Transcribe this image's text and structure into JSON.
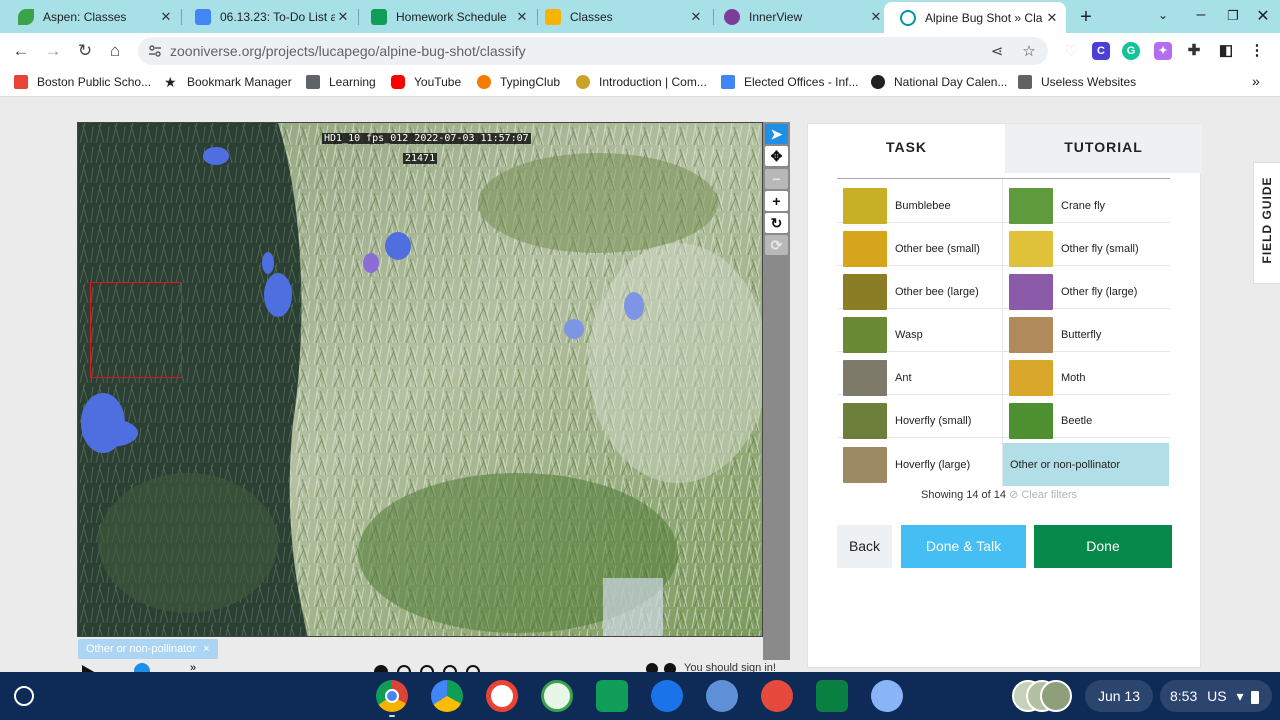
{
  "browser": {
    "tabs": [
      {
        "title": "Aspen: Classes",
        "favicon": "leaf-icon",
        "color": "#3aa24b"
      },
      {
        "title": "06.13.23: To-Do List a",
        "favicon": "docs-icon",
        "color": "#4285f4"
      },
      {
        "title": "Homework Schedule",
        "favicon": "sheets-icon",
        "color": "#0f9d58"
      },
      {
        "title": "Classes",
        "favicon": "classroom-icon",
        "color": "#f4b400"
      },
      {
        "title": "InnerView",
        "favicon": "innerview-icon",
        "color": "#7d3c98"
      },
      {
        "title": "Alpine Bug Shot » Cla",
        "favicon": "zooniverse-icon",
        "color": "#00979d"
      }
    ],
    "new_tab_symbol": "+",
    "url": "zooniverse.org/projects/lucapego/alpine-bug-shot/classify",
    "bookmarks": [
      {
        "label": "Boston Public Scho...",
        "icon": "gmail-icon",
        "color": "#ea4335"
      },
      {
        "label": "Bookmark Manager",
        "icon": "star-icon",
        "color": "#202124"
      },
      {
        "label": "Learning",
        "icon": "folder-icon",
        "color": "#5f6368"
      },
      {
        "label": "YouTube",
        "icon": "youtube-icon",
        "color": "#ff0000"
      },
      {
        "label": "TypingClub",
        "icon": "typingclub-icon",
        "color": "#f57c00"
      },
      {
        "label": "Introduction | Com...",
        "icon": "intro-icon",
        "color": "#c9a227"
      },
      {
        "label": "Elected Offices - Inf...",
        "icon": "docs-icon",
        "color": "#4285f4"
      },
      {
        "label": "National Day Calen...",
        "icon": "globe-icon",
        "color": "#202124"
      },
      {
        "label": "Useless Websites",
        "icon": "folder-icon",
        "color": "#5f6368"
      }
    ],
    "overflow_symbol": "»"
  },
  "subject": {
    "timestamp_overlay": "HD1_10 fps_012  2022-07-03 11:57:07",
    "frame_overlay": "21471"
  },
  "toolbar_tools": [
    {
      "name": "pointer-tool",
      "symbol": "➤",
      "state": "selected"
    },
    {
      "name": "move-tool",
      "symbol": "✥",
      "state": "normal"
    },
    {
      "name": "zoom-out-tool",
      "symbol": "−",
      "state": "disabled"
    },
    {
      "name": "zoom-in-tool",
      "symbol": "+",
      "state": "normal"
    },
    {
      "name": "rotate-tool",
      "symbol": "↻",
      "state": "normal"
    },
    {
      "name": "reset-tool",
      "symbol": "⟳",
      "state": "disabled"
    }
  ],
  "annotation_label": "Other or non-pollinator",
  "annotation_close": "×",
  "signin_note": "You should sign in!",
  "task_panel": {
    "tab_task": "TASK",
    "tab_tutorial": "TUTORIAL",
    "choices": [
      {
        "label": "Bumblebee",
        "thumb": "#c7b026"
      },
      {
        "label": "Crane fly",
        "thumb": "#5f9a3c"
      },
      {
        "label": "Other bee (small)",
        "thumb": "#d6a51c"
      },
      {
        "label": "Other fly (small)",
        "thumb": "#e0c23a"
      },
      {
        "label": "Other bee (large)",
        "thumb": "#8a7d26"
      },
      {
        "label": "Other fly (large)",
        "thumb": "#8b5aa8"
      },
      {
        "label": "Wasp",
        "thumb": "#6b8a34"
      },
      {
        "label": "Butterfly",
        "thumb": "#b08a5a"
      },
      {
        "label": "Ant",
        "thumb": "#7d7a6a"
      },
      {
        "label": "Moth",
        "thumb": "#d9a82a"
      },
      {
        "label": "Hoverfly (small)",
        "thumb": "#6d7f3b"
      },
      {
        "label": "Beetle",
        "thumb": "#4e8f2f"
      },
      {
        "label": "Hoverfly (large)",
        "thumb": "#9c8a63"
      },
      {
        "label": "Other or non-pollinator",
        "thumb": "#b2dfe7",
        "selected": true
      }
    ],
    "showing_text": "Showing 14 of 14",
    "clear_filters": "Clear filters",
    "back_label": "Back",
    "done_talk_label": "Done & Talk",
    "done_label": "Done"
  },
  "field_guide_label": "FIELD GUIDE",
  "shelf": {
    "apps": [
      {
        "name": "chrome-icon",
        "color": "#db4437"
      },
      {
        "name": "google-drive-icon",
        "color": "#fbbc04"
      },
      {
        "name": "gmail-icon",
        "color": "#ea4335"
      },
      {
        "name": "aspen-icon",
        "color": "#3aa24b"
      },
      {
        "name": "classroom-icon",
        "color": "#0f9d58"
      },
      {
        "name": "camera-icon",
        "color": "#1a73e8"
      },
      {
        "name": "print-icon",
        "color": "#5f8fd6"
      },
      {
        "name": "paint-icon",
        "color": "#e64a3c"
      },
      {
        "name": "news-icon",
        "color": "#0b8043"
      },
      {
        "name": "settings-icon",
        "color": "#8ab4f8"
      }
    ],
    "date": "Jun 13",
    "time": "8:53",
    "locale": "US"
  }
}
